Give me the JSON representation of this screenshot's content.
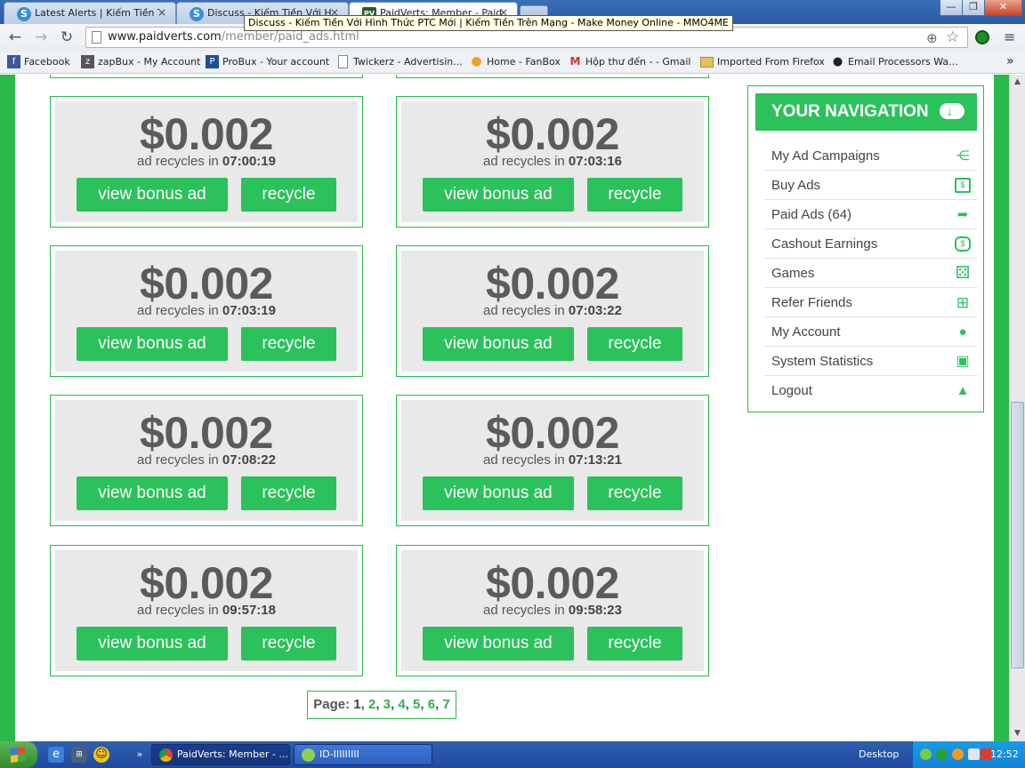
{
  "browser": {
    "tabs": [
      {
        "title": "Latest Alerts | Kiếm Tiền Trê",
        "favicon": "S",
        "active": false
      },
      {
        "title": "Discuss - Kiếm Tiền Với Hìn",
        "favicon": "S",
        "active": false
      },
      {
        "title": "PaidVerts: Member - Paid A",
        "favicon": "PV",
        "active": true
      }
    ],
    "tab_close": "×",
    "tooltip": "Discuss - Kiếm Tiền Với Hình Thức PTC Mới | Kiếm Tiền Trên Mạng - Make Money Online - MMO4ME",
    "window_buttons": {
      "minimize": "—",
      "maximize": "❐",
      "close": "✕"
    },
    "nav": {
      "back": "←",
      "forward": "→",
      "reload": "↻"
    },
    "url": {
      "host": "www.paidverts.com",
      "path": "/member/paid_ads.html"
    },
    "omnibox_icons": {
      "zoom": "⊕",
      "star": "☆"
    },
    "menu": "≡",
    "bookmarks": [
      {
        "label": "Facebook",
        "icon": "f",
        "color": "#3b5998"
      },
      {
        "label": "zapBux - My Account",
        "icon": "z",
        "color": "#555"
      },
      {
        "label": "ProBux - Your account",
        "icon": "P",
        "color": "#1d4f91"
      },
      {
        "label": "Twickerz - Advertisin...",
        "icon": "",
        "color": "#fff"
      },
      {
        "label": "Home - FanBox",
        "icon": "●",
        "color": "#f0a020"
      },
      {
        "label": "Hộp thư đến -  - Gmail",
        "icon": "M",
        "color": "#d93025"
      },
      {
        "label": "Imported From Firefox",
        "icon": "",
        "color": "#e8c060"
      },
      {
        "label": "Email Processors Wa...",
        "icon": "●",
        "color": "#222"
      }
    ],
    "bookmarks_overflow": "»"
  },
  "ads": [
    {
      "amount": "$0.002",
      "prefix": "ad recycles in",
      "time": "07:00:19"
    },
    {
      "amount": "$0.002",
      "prefix": "ad recycles in",
      "time": "07:03:16"
    },
    {
      "amount": "$0.002",
      "prefix": "ad recycles in",
      "time": "07:03:19"
    },
    {
      "amount": "$0.002",
      "prefix": "ad recycles in",
      "time": "07:03:22"
    },
    {
      "amount": "$0.002",
      "prefix": "ad recycles in",
      "time": "07:08:22"
    },
    {
      "amount": "$0.002",
      "prefix": "ad recycles in",
      "time": "07:13:21"
    },
    {
      "amount": "$0.002",
      "prefix": "ad recycles in",
      "time": "09:57:18"
    },
    {
      "amount": "$0.002",
      "prefix": "ad recycles in",
      "time": "09:58:23"
    }
  ],
  "ad_buttons": {
    "bonus": "view bonus ad",
    "recycle": "recycle"
  },
  "pager": {
    "label": "Page:",
    "current": "1",
    "pages": [
      "2",
      "3",
      "4",
      "5",
      "6",
      "7"
    ],
    "separator": ","
  },
  "navigation": {
    "title": "YOUR NAVIGATION",
    "items": [
      {
        "label": "My Ad Campaigns",
        "icon": "share-icon"
      },
      {
        "label": "Buy Ads",
        "icon": "money-icon"
      },
      {
        "label": "Paid Ads (64)",
        "icon": "forward-icon"
      },
      {
        "label": "Cashout Earnings",
        "icon": "money-bag-icon"
      },
      {
        "label": "Games",
        "icon": "dice-icon"
      },
      {
        "label": "Refer Friends",
        "icon": "sitemap-icon"
      },
      {
        "label": "My Account",
        "icon": "user-icon"
      },
      {
        "label": "System Statistics",
        "icon": "presentation-icon"
      },
      {
        "label": "Logout",
        "icon": "cloud-upload-icon"
      }
    ],
    "glyphs": [
      "⋲",
      "$",
      "➦",
      "$",
      "⚄",
      "⊞",
      "●",
      "▣",
      "▲"
    ]
  },
  "taskbar": {
    "tasks": [
      {
        "label": "PaidVerts: Member - ...",
        "active": true
      },
      {
        "label": "ID-IIIIIIIII",
        "active": false
      }
    ],
    "desktop_label": "Desktop",
    "clock": "12:52"
  },
  "colors": {
    "brand_green": "#2bc15b",
    "border_green": "#2aba4a",
    "link_green": "#2bb34e"
  }
}
